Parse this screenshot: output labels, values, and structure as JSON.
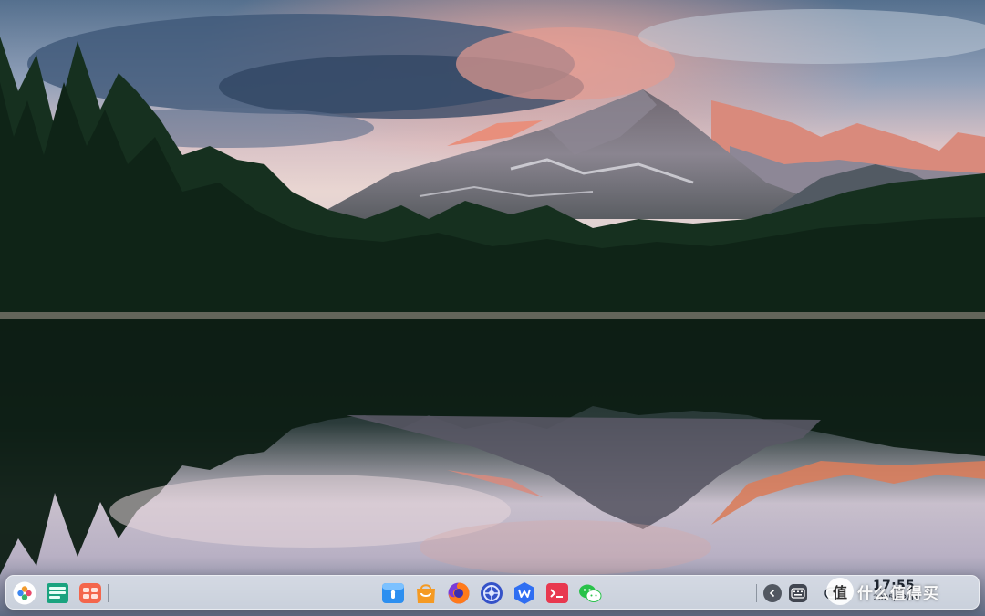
{
  "desktop": {
    "wallpaper": "Mountain lake at sunrise reflecting pine forest and snow-capped peaks"
  },
  "dock": {
    "left_items": [
      {
        "id": "launcher",
        "icon": "launcher-icon"
      },
      {
        "id": "multitask-view",
        "icon": "multitask-view-icon"
      },
      {
        "id": "workspace-switcher",
        "icon": "workspace-icon"
      }
    ],
    "apps": [
      {
        "id": "file-manager",
        "icon": "file-manager-icon",
        "active": true
      },
      {
        "id": "app-store",
        "icon": "app-store-icon"
      },
      {
        "id": "firefox",
        "icon": "firefox-icon"
      },
      {
        "id": "settings",
        "icon": "settings-icon"
      },
      {
        "id": "wps-office",
        "icon": "wps-icon"
      },
      {
        "id": "terminal",
        "icon": "terminal-icon"
      },
      {
        "id": "wechat",
        "icon": "wechat-icon"
      }
    ],
    "tray": [
      {
        "id": "tray-expand",
        "icon": "chevron-left-icon"
      },
      {
        "id": "keyboard",
        "icon": "keyboard-icon"
      },
      {
        "id": "toggle",
        "icon": "toggle-icon"
      }
    ],
    "clock": {
      "time": "17:55",
      "date": "2025/12/10"
    }
  },
  "watermark": {
    "logo_text": "值",
    "text": "什么值得买"
  },
  "colors": {
    "dock_bg": "#e2e8f0",
    "sky_top": "#4a6a8e",
    "sunset_pink": "#e89a8a",
    "lake_dark": "#15211c"
  }
}
